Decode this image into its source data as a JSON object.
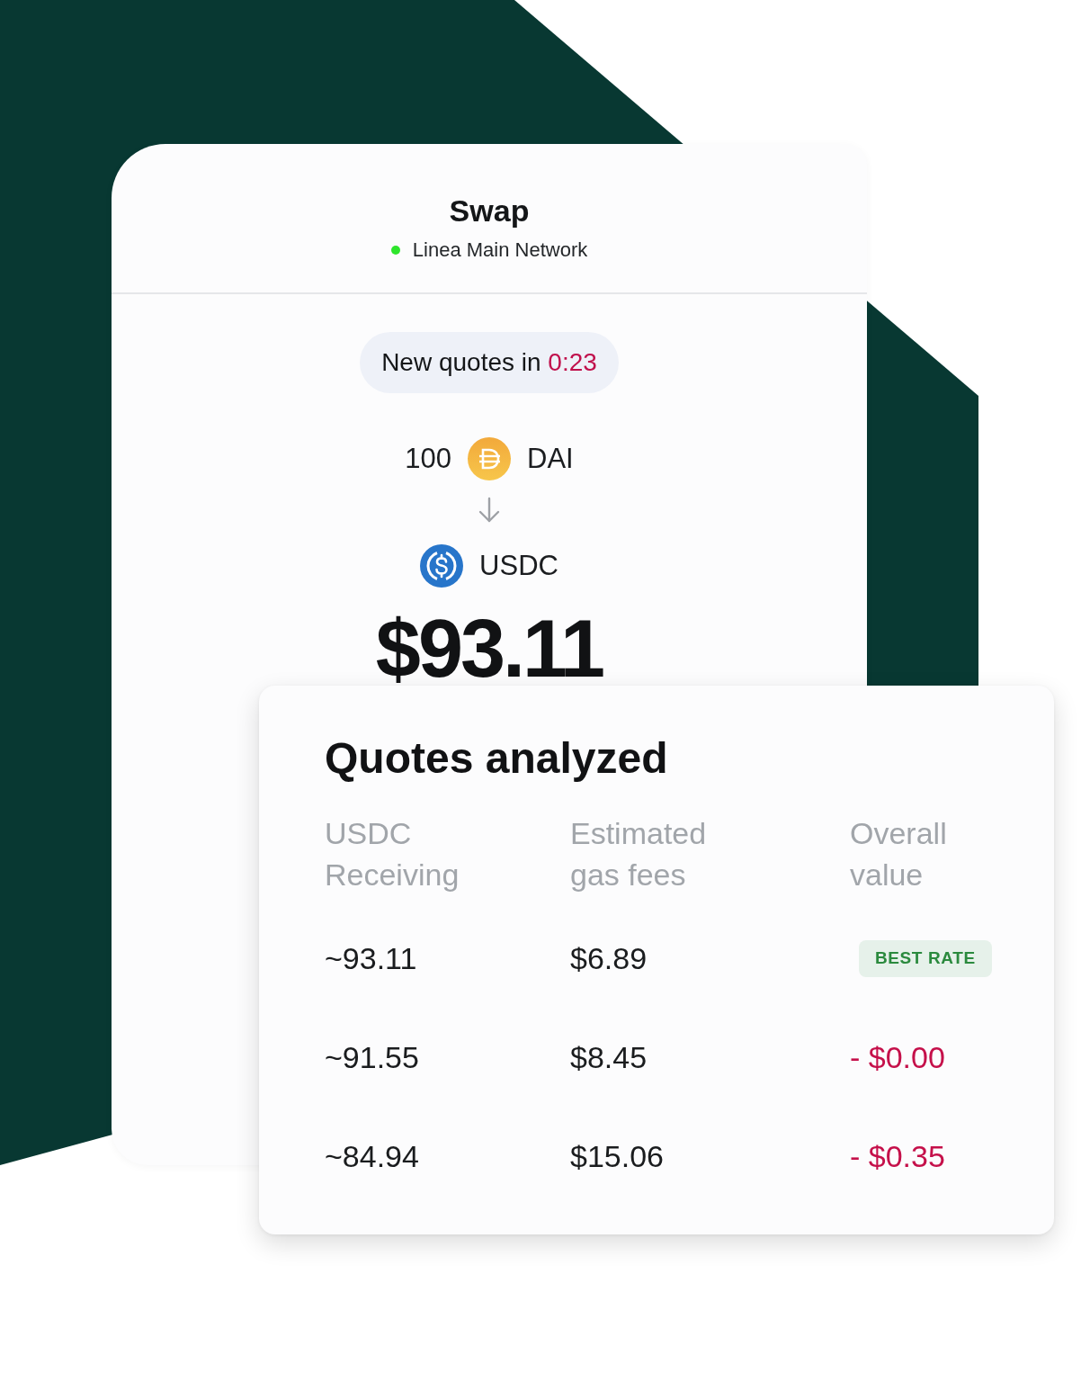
{
  "swap_card": {
    "title": "Swap",
    "network": {
      "name": "Linea Main Network",
      "connected": true
    },
    "quote_timer": {
      "label": "New quotes in",
      "time": "0:23"
    },
    "from": {
      "amount": "100",
      "token": "DAI"
    },
    "to": {
      "token": "USDC",
      "value": "$93.11"
    }
  },
  "quotes_card": {
    "title": "Quotes analyzed",
    "columns": [
      "USDC Receiving",
      "Estimated gas fees",
      "Overall value"
    ],
    "rows": [
      {
        "receiving": "~93.11",
        "gas_fees": "$6.89",
        "overall": {
          "kind": "badge",
          "text": "BEST RATE"
        }
      },
      {
        "receiving": "~91.55",
        "gas_fees": "$8.45",
        "overall": {
          "kind": "difference",
          "text": "- $0.00"
        }
      },
      {
        "receiving": "~84.94",
        "gas_fees": "$15.06",
        "overall": {
          "kind": "difference",
          "text": "- $0.35"
        }
      }
    ]
  }
}
